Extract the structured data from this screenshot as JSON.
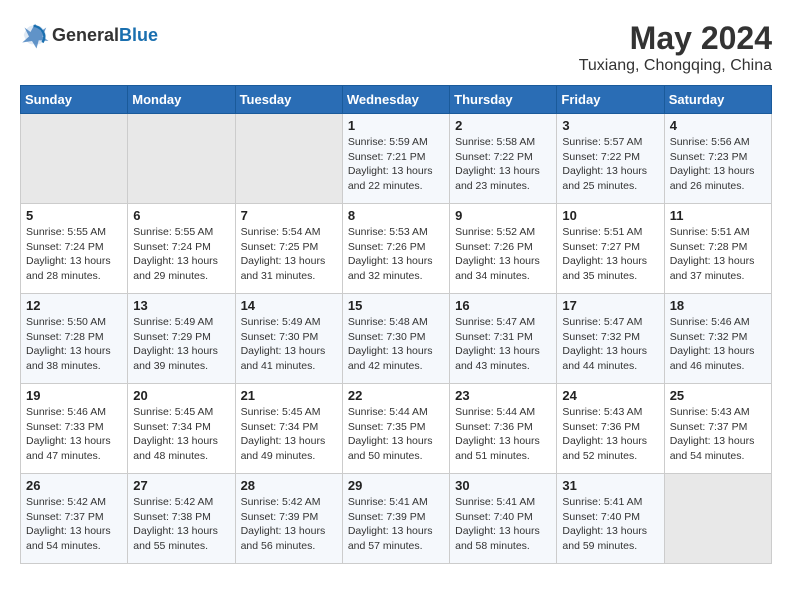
{
  "header": {
    "logo_general": "General",
    "logo_blue": "Blue",
    "month_year": "May 2024",
    "location": "Tuxiang, Chongqing, China"
  },
  "weekdays": [
    "Sunday",
    "Monday",
    "Tuesday",
    "Wednesday",
    "Thursday",
    "Friday",
    "Saturday"
  ],
  "weeks": [
    [
      {
        "day": "",
        "info": ""
      },
      {
        "day": "",
        "info": ""
      },
      {
        "day": "",
        "info": ""
      },
      {
        "day": "1",
        "info": "Sunrise: 5:59 AM\nSunset: 7:21 PM\nDaylight: 13 hours\nand 22 minutes."
      },
      {
        "day": "2",
        "info": "Sunrise: 5:58 AM\nSunset: 7:22 PM\nDaylight: 13 hours\nand 23 minutes."
      },
      {
        "day": "3",
        "info": "Sunrise: 5:57 AM\nSunset: 7:22 PM\nDaylight: 13 hours\nand 25 minutes."
      },
      {
        "day": "4",
        "info": "Sunrise: 5:56 AM\nSunset: 7:23 PM\nDaylight: 13 hours\nand 26 minutes."
      }
    ],
    [
      {
        "day": "5",
        "info": "Sunrise: 5:55 AM\nSunset: 7:24 PM\nDaylight: 13 hours\nand 28 minutes."
      },
      {
        "day": "6",
        "info": "Sunrise: 5:55 AM\nSunset: 7:24 PM\nDaylight: 13 hours\nand 29 minutes."
      },
      {
        "day": "7",
        "info": "Sunrise: 5:54 AM\nSunset: 7:25 PM\nDaylight: 13 hours\nand 31 minutes."
      },
      {
        "day": "8",
        "info": "Sunrise: 5:53 AM\nSunset: 7:26 PM\nDaylight: 13 hours\nand 32 minutes."
      },
      {
        "day": "9",
        "info": "Sunrise: 5:52 AM\nSunset: 7:26 PM\nDaylight: 13 hours\nand 34 minutes."
      },
      {
        "day": "10",
        "info": "Sunrise: 5:51 AM\nSunset: 7:27 PM\nDaylight: 13 hours\nand 35 minutes."
      },
      {
        "day": "11",
        "info": "Sunrise: 5:51 AM\nSunset: 7:28 PM\nDaylight: 13 hours\nand 37 minutes."
      }
    ],
    [
      {
        "day": "12",
        "info": "Sunrise: 5:50 AM\nSunset: 7:28 PM\nDaylight: 13 hours\nand 38 minutes."
      },
      {
        "day": "13",
        "info": "Sunrise: 5:49 AM\nSunset: 7:29 PM\nDaylight: 13 hours\nand 39 minutes."
      },
      {
        "day": "14",
        "info": "Sunrise: 5:49 AM\nSunset: 7:30 PM\nDaylight: 13 hours\nand 41 minutes."
      },
      {
        "day": "15",
        "info": "Sunrise: 5:48 AM\nSunset: 7:30 PM\nDaylight: 13 hours\nand 42 minutes."
      },
      {
        "day": "16",
        "info": "Sunrise: 5:47 AM\nSunset: 7:31 PM\nDaylight: 13 hours\nand 43 minutes."
      },
      {
        "day": "17",
        "info": "Sunrise: 5:47 AM\nSunset: 7:32 PM\nDaylight: 13 hours\nand 44 minutes."
      },
      {
        "day": "18",
        "info": "Sunrise: 5:46 AM\nSunset: 7:32 PM\nDaylight: 13 hours\nand 46 minutes."
      }
    ],
    [
      {
        "day": "19",
        "info": "Sunrise: 5:46 AM\nSunset: 7:33 PM\nDaylight: 13 hours\nand 47 minutes."
      },
      {
        "day": "20",
        "info": "Sunrise: 5:45 AM\nSunset: 7:34 PM\nDaylight: 13 hours\nand 48 minutes."
      },
      {
        "day": "21",
        "info": "Sunrise: 5:45 AM\nSunset: 7:34 PM\nDaylight: 13 hours\nand 49 minutes."
      },
      {
        "day": "22",
        "info": "Sunrise: 5:44 AM\nSunset: 7:35 PM\nDaylight: 13 hours\nand 50 minutes."
      },
      {
        "day": "23",
        "info": "Sunrise: 5:44 AM\nSunset: 7:36 PM\nDaylight: 13 hours\nand 51 minutes."
      },
      {
        "day": "24",
        "info": "Sunrise: 5:43 AM\nSunset: 7:36 PM\nDaylight: 13 hours\nand 52 minutes."
      },
      {
        "day": "25",
        "info": "Sunrise: 5:43 AM\nSunset: 7:37 PM\nDaylight: 13 hours\nand 54 minutes."
      }
    ],
    [
      {
        "day": "26",
        "info": "Sunrise: 5:42 AM\nSunset: 7:37 PM\nDaylight: 13 hours\nand 54 minutes."
      },
      {
        "day": "27",
        "info": "Sunrise: 5:42 AM\nSunset: 7:38 PM\nDaylight: 13 hours\nand 55 minutes."
      },
      {
        "day": "28",
        "info": "Sunrise: 5:42 AM\nSunset: 7:39 PM\nDaylight: 13 hours\nand 56 minutes."
      },
      {
        "day": "29",
        "info": "Sunrise: 5:41 AM\nSunset: 7:39 PM\nDaylight: 13 hours\nand 57 minutes."
      },
      {
        "day": "30",
        "info": "Sunrise: 5:41 AM\nSunset: 7:40 PM\nDaylight: 13 hours\nand 58 minutes."
      },
      {
        "day": "31",
        "info": "Sunrise: 5:41 AM\nSunset: 7:40 PM\nDaylight: 13 hours\nand 59 minutes."
      },
      {
        "day": "",
        "info": ""
      }
    ]
  ]
}
